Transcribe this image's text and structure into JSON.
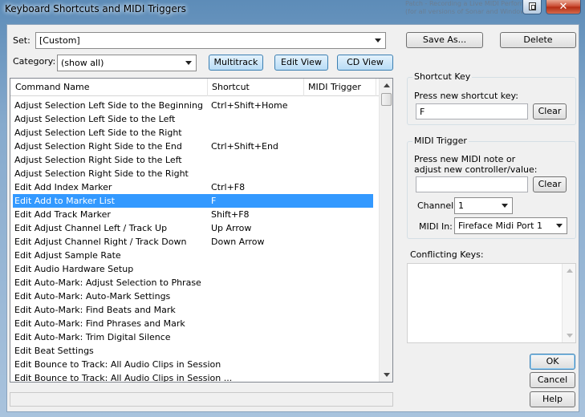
{
  "window": {
    "title": "Keyboard Shortcuts and MIDI Triggers",
    "background_text": [
      "Patch - Recording a Live MIDI Performance",
      "(for all versions of Sonar and Windows)"
    ],
    "help_icon": "context-help-icon",
    "close_glyph": "✕"
  },
  "set": {
    "label": "Set:",
    "value": "[Custom]"
  },
  "category": {
    "label": "Category:",
    "value": "(show all)"
  },
  "view_buttons": [
    "Multitrack",
    "Edit View",
    "CD View"
  ],
  "actions": {
    "save_as": "Save As...",
    "delete": "Delete"
  },
  "list": {
    "columns": [
      "Command Name",
      "Shortcut",
      "MIDI Trigger"
    ],
    "rows": [
      {
        "name": "Adjust Selection Left Side to the Beginning",
        "shortcut": "Ctrl+Shift+Home"
      },
      {
        "name": "Adjust Selection Left Side to the Left",
        "shortcut": ""
      },
      {
        "name": "Adjust Selection Left Side to the Right",
        "shortcut": ""
      },
      {
        "name": "Adjust Selection Right Side to the End",
        "shortcut": "Ctrl+Shift+End"
      },
      {
        "name": "Adjust Selection Right Side to the Left",
        "shortcut": ""
      },
      {
        "name": "Adjust Selection Right Side to the Right",
        "shortcut": ""
      },
      {
        "name": "Edit Add Index Marker",
        "shortcut": "Ctrl+F8"
      },
      {
        "name": "Edit Add to Marker List",
        "shortcut": "F",
        "selected": true
      },
      {
        "name": "Edit Add Track Marker",
        "shortcut": "Shift+F8"
      },
      {
        "name": "Edit Adjust Channel Left / Track Up",
        "shortcut": "Up Arrow"
      },
      {
        "name": "Edit Adjust Channel Right / Track Down",
        "shortcut": "Down Arrow"
      },
      {
        "name": "Edit Adjust Sample Rate",
        "shortcut": ""
      },
      {
        "name": "Edit Audio Hardware Setup",
        "shortcut": ""
      },
      {
        "name": "Edit Auto-Mark: Adjust Selection to Phrase",
        "shortcut": ""
      },
      {
        "name": "Edit Auto-Mark: Auto-Mark Settings",
        "shortcut": ""
      },
      {
        "name": "Edit Auto-Mark: Find Beats and Mark",
        "shortcut": ""
      },
      {
        "name": "Edit Auto-Mark: Find Phrases and Mark",
        "shortcut": ""
      },
      {
        "name": "Edit Auto-Mark: Trim Digital Silence",
        "shortcut": ""
      },
      {
        "name": "Edit Beat Settings",
        "shortcut": ""
      },
      {
        "name": "Edit Bounce to Track: All Audio Clips in Session",
        "shortcut": ""
      },
      {
        "name": "Edit Bounce to Track: All Audio Clips in Session ...",
        "shortcut": ""
      }
    ]
  },
  "shortcut_key": {
    "title": "Shortcut Key",
    "prompt": "Press new shortcut key:",
    "value": "F",
    "clear": "Clear"
  },
  "midi_trigger": {
    "title": "MIDI Trigger",
    "prompt_line1": "Press new MIDI note or",
    "prompt_line2": "adjust new controller/value:",
    "value": "",
    "clear": "Clear",
    "channel_label": "Channel:",
    "channel_value": "1",
    "midi_in_label": "MIDI In:",
    "midi_in_value": "Fireface Midi Port 1"
  },
  "conflicting": {
    "title": "Conflicting Keys:"
  },
  "footer": {
    "ok": "OK",
    "cancel": "Cancel",
    "help": "Help"
  }
}
